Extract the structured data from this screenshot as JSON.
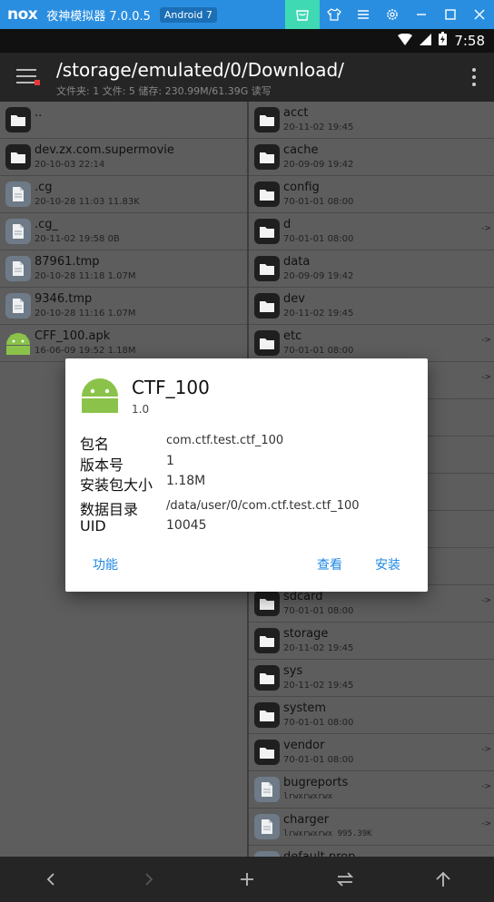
{
  "emulator": {
    "logo": "nox",
    "title": "夜神模拟器 7.0.0.5",
    "android_badge": "Android 7",
    "icons": [
      "shop-icon",
      "shirt-icon",
      "menu-icon",
      "gear-icon",
      "minimize-icon",
      "maximize-icon",
      "close-icon"
    ]
  },
  "status_bar": {
    "time": "7:58"
  },
  "toolbar": {
    "path": "/storage/emulated/0/Download/",
    "info": "文件夹: 1  文件: 5  储存: 230.99M/61.39G  读写"
  },
  "left_pane": [
    {
      "name": "..",
      "meta": "",
      "type": "folder"
    },
    {
      "name": "dev.zx.com.supermovie",
      "meta": "20-10-03 22:14",
      "type": "folder"
    },
    {
      "name": ".cg",
      "meta": "20-10-28 11:03  11.83K",
      "type": "file"
    },
    {
      "name": ".cg_",
      "meta": "20-11-02 19:58  0B",
      "type": "file"
    },
    {
      "name": "87961.tmp",
      "meta": "20-10-28 11:18  1.07M",
      "type": "file"
    },
    {
      "name": "9346.tmp",
      "meta": "20-10-28 11:16  1.07M",
      "type": "file"
    },
    {
      "name": "CFF_100.apk",
      "meta": "16-06-09 19:52  1.18M",
      "type": "apk"
    }
  ],
  "right_pane": [
    {
      "name": "acct",
      "meta": "20-11-02 19:45",
      "type": "folder",
      "link": ""
    },
    {
      "name": "cache",
      "meta": "20-09-09 19:42",
      "type": "folder",
      "link": ""
    },
    {
      "name": "config",
      "meta": "70-01-01 08:00",
      "type": "folder",
      "link": ""
    },
    {
      "name": "d",
      "meta": "70-01-01 08:00",
      "type": "folder",
      "link": "->"
    },
    {
      "name": "data",
      "meta": "20-09-09 19:42",
      "type": "folder",
      "link": ""
    },
    {
      "name": "dev",
      "meta": "20-11-02 19:45",
      "type": "folder",
      "link": ""
    },
    {
      "name": "etc",
      "meta": "70-01-01 08:00",
      "type": "folder",
      "link": "->"
    },
    {
      "name": "",
      "meta": "",
      "type": "folder",
      "link": "->"
    },
    {
      "name": "",
      "meta": "",
      "type": "folder",
      "link": ""
    },
    {
      "name": "",
      "meta": "",
      "type": "folder",
      "link": ""
    },
    {
      "name": "",
      "meta": "",
      "type": "folder",
      "link": ""
    },
    {
      "name": "",
      "meta": "",
      "type": "folder",
      "link": ""
    },
    {
      "name": "",
      "meta": "",
      "type": "folder",
      "link": ""
    },
    {
      "name": "sdcard",
      "meta": "70-01-01 08:00",
      "type": "folder",
      "link": "->"
    },
    {
      "name": "storage",
      "meta": "20-11-02 19:45",
      "type": "folder",
      "link": ""
    },
    {
      "name": "sys",
      "meta": "20-11-02 19:45",
      "type": "folder",
      "link": ""
    },
    {
      "name": "system",
      "meta": "70-01-01 08:00",
      "type": "folder",
      "link": ""
    },
    {
      "name": "vendor",
      "meta": "70-01-01 08:00",
      "type": "folder",
      "link": "->"
    },
    {
      "name": "bugreports",
      "meta": "lrwxrwxrwx",
      "type": "file",
      "link": "->"
    },
    {
      "name": "charger",
      "meta": "lrwxrwxrwx 995.39K",
      "type": "file",
      "link": "->"
    },
    {
      "name": "default.prop",
      "meta": "",
      "type": "file",
      "link": ""
    }
  ],
  "dialog": {
    "app_name": "CTF_100",
    "version": "1.0",
    "package_label": "包名",
    "package_value": "com.ctf.test.ctf_100",
    "version_code_label": "版本号",
    "version_code_value": "1",
    "size_label": "安装包大小",
    "size_value": "1.18M",
    "data_dir_label": "数据目录",
    "data_dir_value": "/data/user/0/com.ctf.test.ctf_100",
    "uid_label": "UID",
    "uid_value": "10045",
    "btn_function": "功能",
    "btn_view": "查看",
    "btn_install": "安装"
  },
  "colors": {
    "emulator_bar": "#2a8ee0",
    "accent": "#1e88e5",
    "active_tab": "#3fd9b4"
  },
  "bottom_nav": [
    "back-icon",
    "forward-icon",
    "add-icon",
    "swap-icon",
    "up-icon"
  ]
}
